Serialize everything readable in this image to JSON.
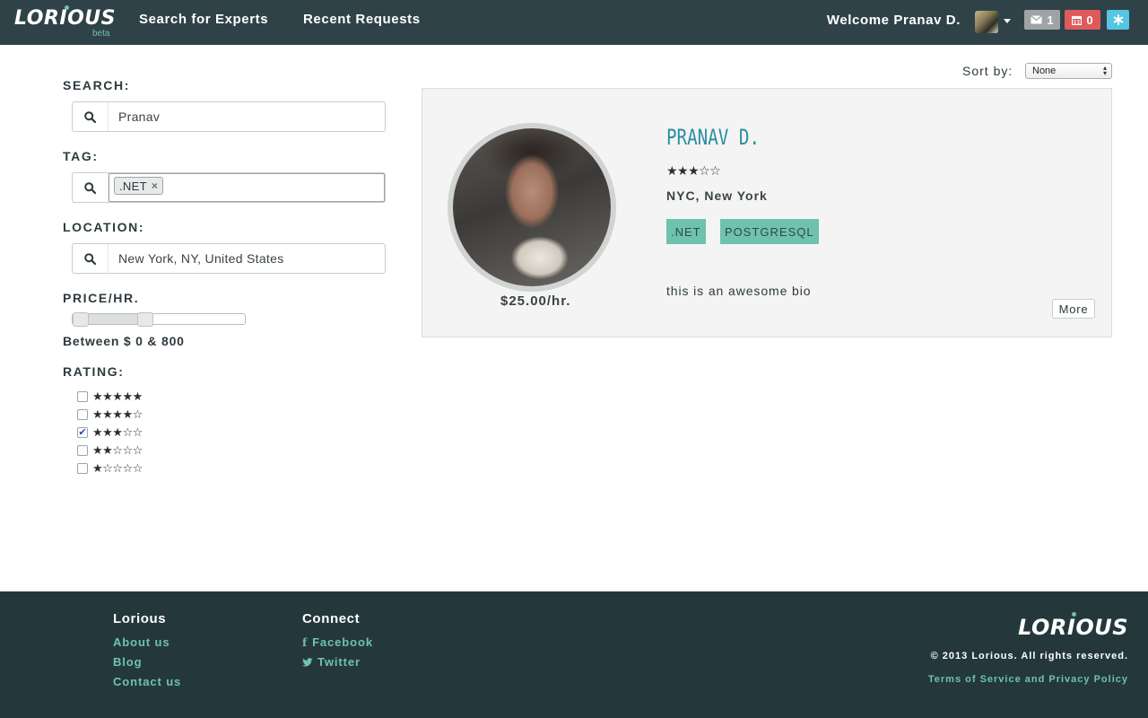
{
  "header": {
    "logo": "LORIOUS",
    "logo_badge": "beta",
    "nav": [
      "Search for Experts",
      "Recent Requests"
    ],
    "welcome": "Welcome Pranav D.",
    "messages_count": "1",
    "calendar_count": "0"
  },
  "filters": {
    "search_label": "SEARCH:",
    "search_value": "Pranav",
    "tag_label": "TAG:",
    "tags": [
      ".NET"
    ],
    "tag_remove": "×",
    "location_label": "LOCATION:",
    "location_value": "New York, NY, United States",
    "price_label": "PRICE/HR.",
    "price_min": 0,
    "price_max": 800,
    "price_text": "Between $ 0 & 800",
    "rating_label": "RATING:",
    "ratings": [
      {
        "stars": 5,
        "checked": false
      },
      {
        "stars": 4,
        "checked": false
      },
      {
        "stars": 3,
        "checked": true
      },
      {
        "stars": 2,
        "checked": false
      },
      {
        "stars": 1,
        "checked": false
      }
    ]
  },
  "sort": {
    "label": "Sort by:",
    "selected": "None"
  },
  "result": {
    "name": "PRANAV D.",
    "rating": 3,
    "max_rating": 5,
    "location": "NYC, New York",
    "skills": [
      ".NET",
      "POSTGRESQL"
    ],
    "bio": "this is an awesome bio",
    "price": "$25.00/hr.",
    "more_label": "More"
  },
  "footer": {
    "col1_heading": "Lorious",
    "col1_links": [
      "About us",
      "Blog",
      "Contact us"
    ],
    "col2_heading": "Connect",
    "col2_links": [
      "Facebook",
      "Twitter"
    ],
    "logo": "LORIOUS",
    "copyright": "© 2013 Lorious. All rights reserved.",
    "terms": "Terms of Service and Privacy Policy"
  },
  "colors": {
    "nav_bg": "#2f4247",
    "footer_bg": "#24383c",
    "accent": "#6fc2ad",
    "name_color": "#2a8fa0",
    "badge_messages": "#9ea4a5",
    "badge_calendar": "#df5a5a",
    "badge_settings": "#56c4e3"
  },
  "icons": [
    "search-icon",
    "envelope-icon",
    "calendar-icon",
    "settings-icon",
    "caret-down-icon",
    "facebook-icon",
    "twitter-icon",
    "star-icon"
  ]
}
